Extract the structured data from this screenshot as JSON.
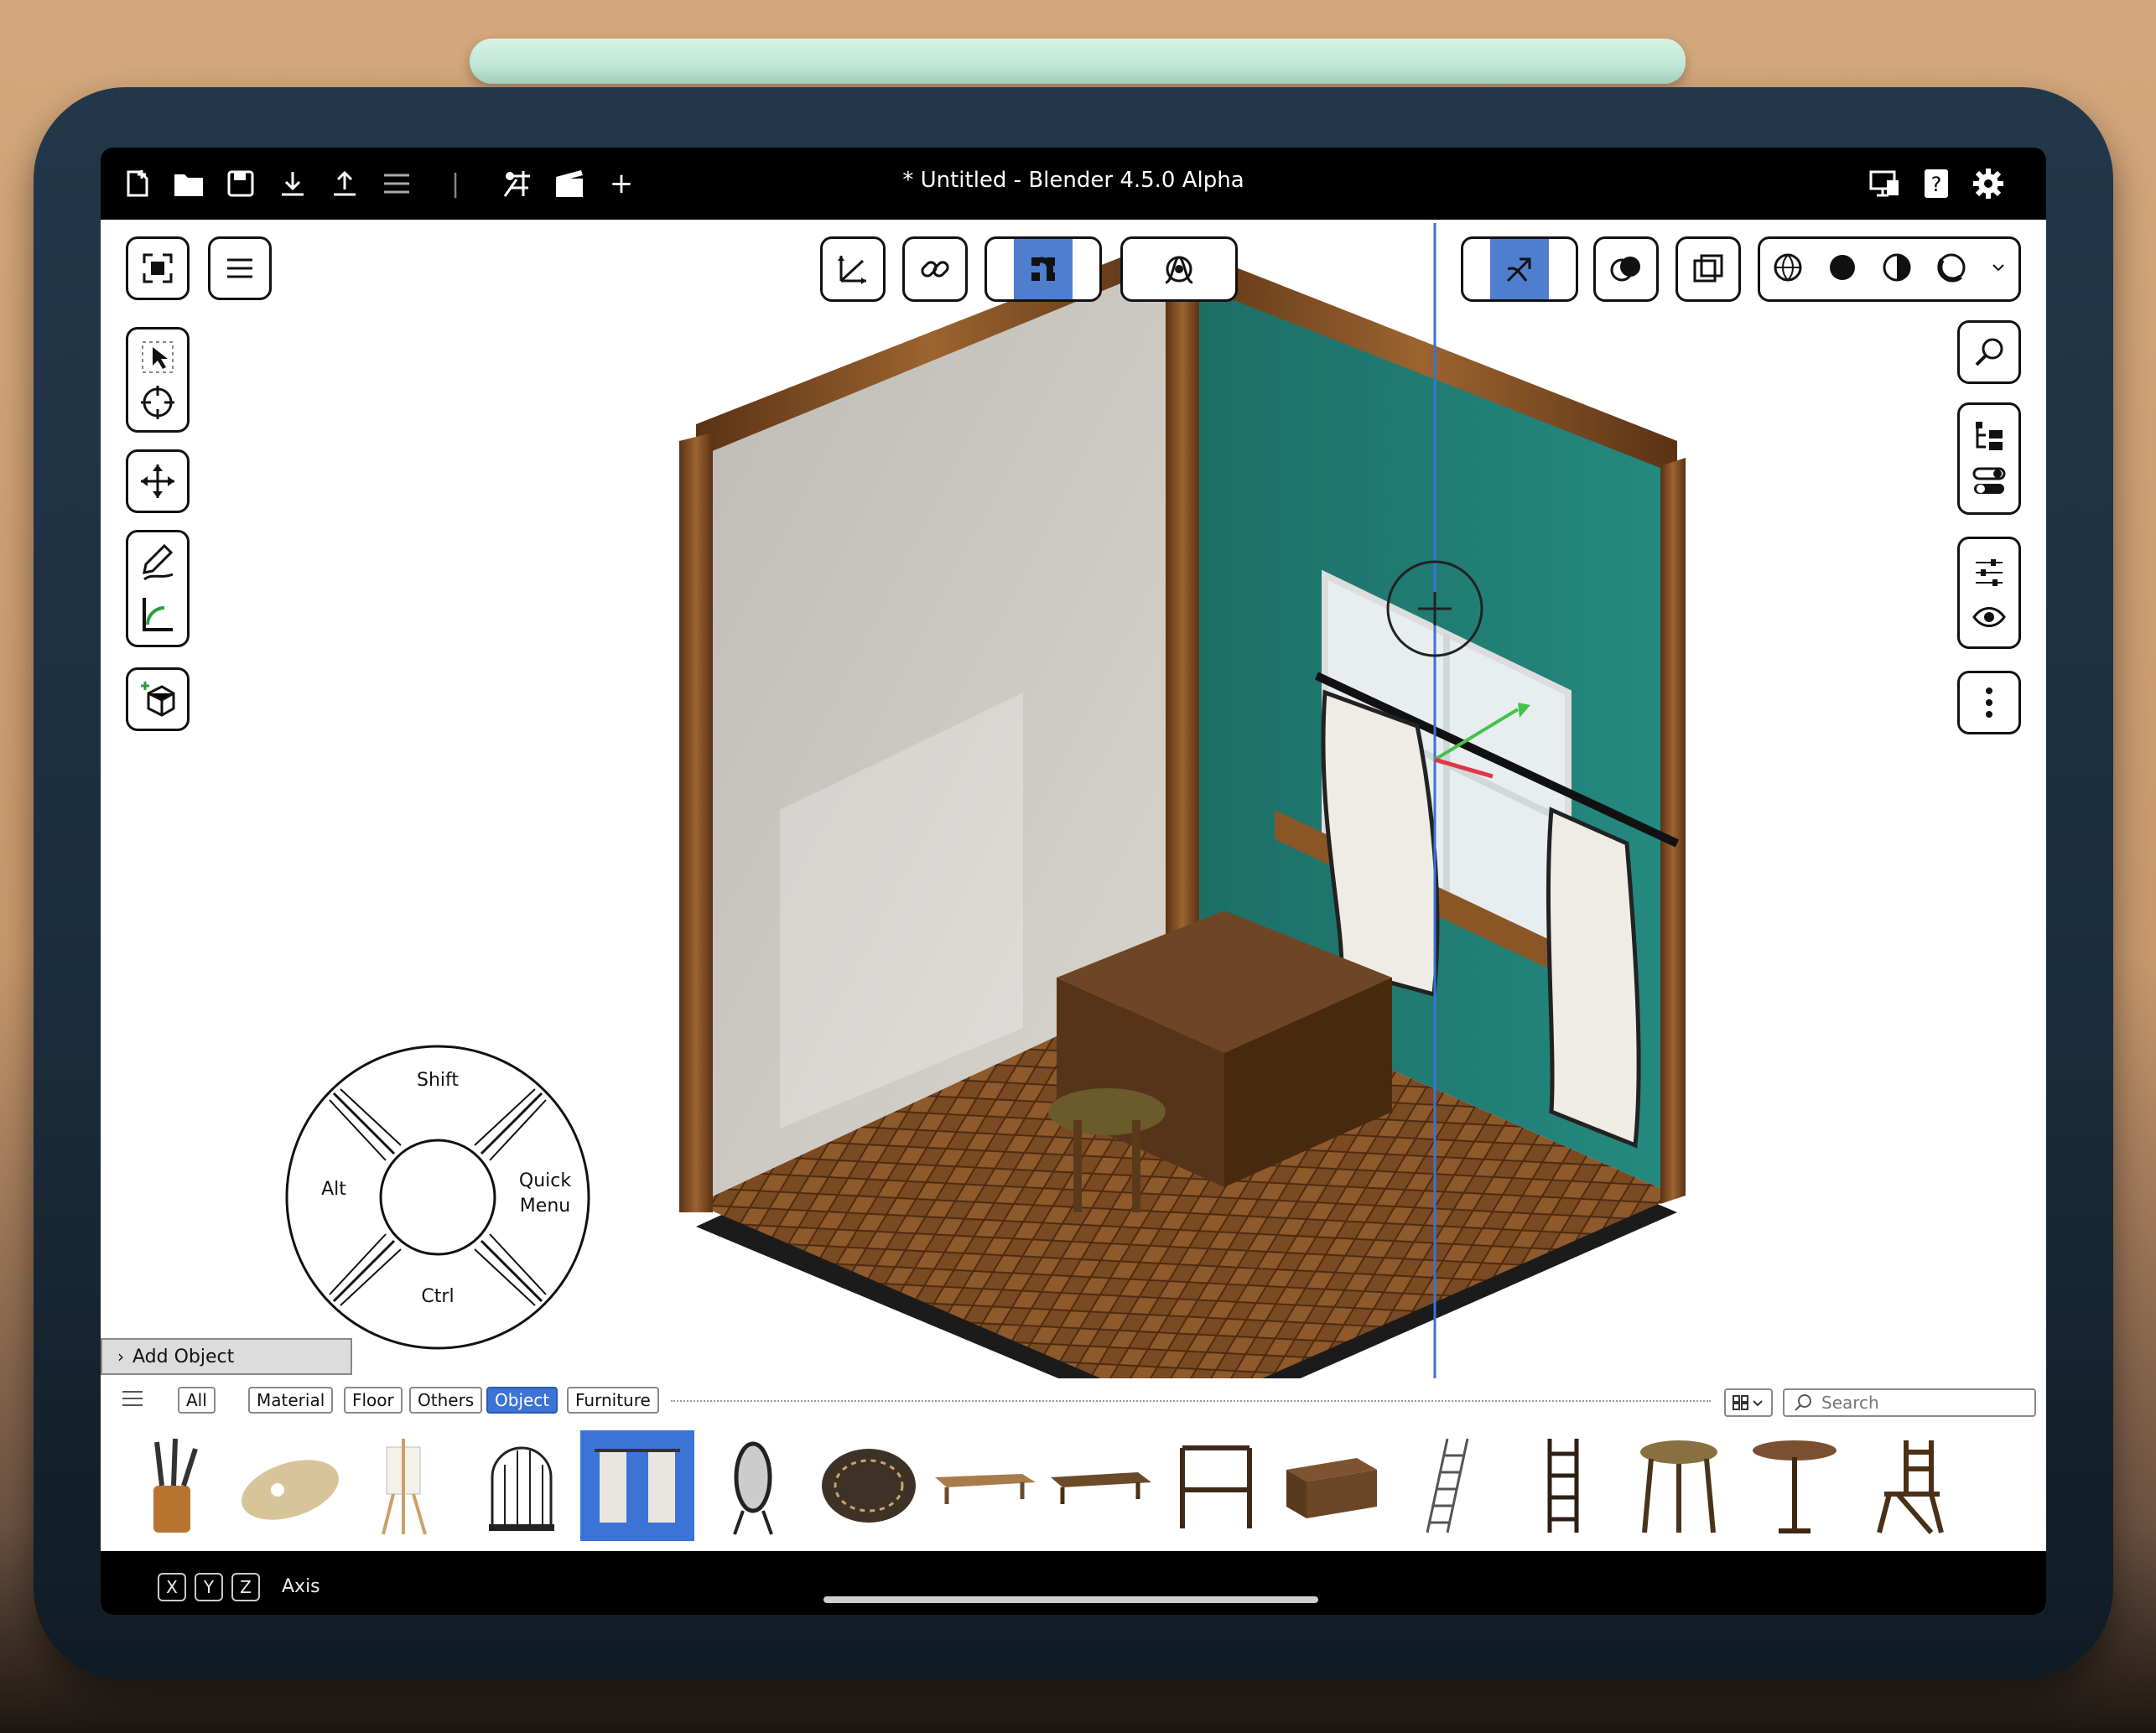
{
  "window": {
    "title": "* Untitled - Blender 4.5.0 Alpha"
  },
  "topbar": {
    "left_icons": [
      "new-file-icon",
      "open-folder-icon",
      "save-icon",
      "import-icon",
      "export-icon",
      "menu-icon",
      "scene-icon",
      "render-icon",
      "add-icon"
    ],
    "right_icons": [
      "display-icon",
      "help-icon",
      "settings-icon"
    ]
  },
  "pie_menu": {
    "top": "Shift",
    "left": "Alt",
    "right": "Quick\nMenu",
    "bottom": "Ctrl"
  },
  "add_object": {
    "label": "Add Object"
  },
  "asset_browser": {
    "tabs": [
      {
        "label": "All",
        "active": false
      },
      {
        "label": "Material",
        "active": false
      },
      {
        "label": "Floor",
        "active": false
      },
      {
        "label": "Others",
        "active": false
      },
      {
        "label": "Object",
        "active": true
      },
      {
        "label": "Furniture",
        "active": false
      }
    ],
    "search_placeholder": "Search",
    "items": [
      "brushes",
      "palette",
      "easel",
      "birdcage",
      "curtains",
      "standing-mirror",
      "round-rug",
      "bench",
      "low-table",
      "shelf",
      "dresser",
      "ladder-thin",
      "ladder",
      "round-stool",
      "side-table",
      "folding-chair"
    ],
    "selected_item": "curtains"
  },
  "statusbar": {
    "keys": [
      "X",
      "Y",
      "Z"
    ],
    "label": "Axis"
  },
  "colors": {
    "accent": "#4f7ecf",
    "tab_active": "#3b73d6",
    "wall_teal": "#1f7d74",
    "wood": "#7a4a22"
  }
}
